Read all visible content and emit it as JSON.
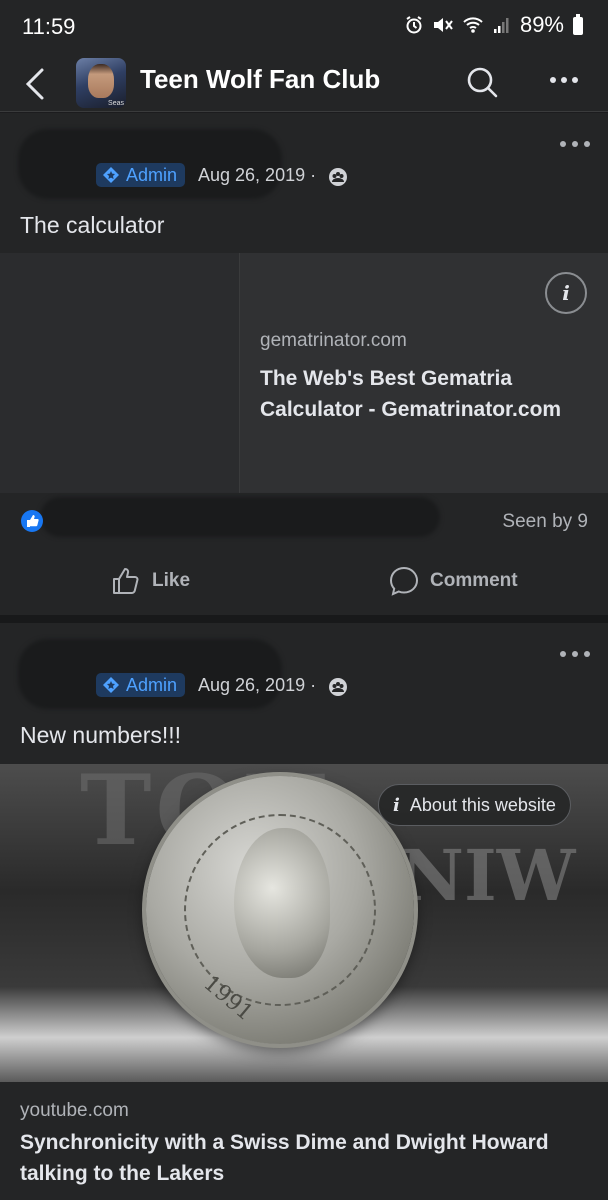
{
  "status_bar": {
    "time": "11:59",
    "battery": "89%"
  },
  "header": {
    "back_icon": "chevron-left-icon",
    "group_name": "Teen Wolf Fan Club",
    "avatar_tag": "Seas",
    "search_icon": "search-icon",
    "more_icon": "more-horizontal-icon"
  },
  "posts": [
    {
      "role_badge": "Admin",
      "date": "Aug 26, 2019 ·",
      "text": "The calculator",
      "link": {
        "domain": "gematrinator.com",
        "title": "The Web's Best Gematria Calculator - Gematrinator.com",
        "info_label": "i"
      },
      "seen_by": "Seen by 9",
      "actions": {
        "like": "Like",
        "comment": "Comment"
      }
    },
    {
      "role_badge": "Admin",
      "date": "Aug 26, 2019 ·",
      "text": "New numbers!!!",
      "image": {
        "about_label": "About this website",
        "background_text_1": "TOU",
        "background_text_2": "NIW",
        "coin_year": "1991"
      },
      "link": {
        "domain": "youtube.com",
        "title": "Synchronicity with a Swiss Dime and Dwight Howard talking to the Lakers"
      }
    }
  ],
  "colors": {
    "background": "#18191a",
    "surface": "#242526",
    "admin_badge_text": "#4ea1ff",
    "admin_badge_bg": "#1e3a5f"
  }
}
